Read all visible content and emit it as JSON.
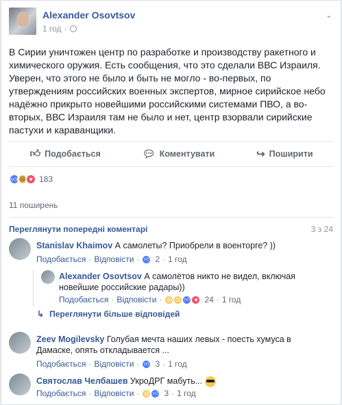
{
  "post": {
    "author": "Alexander Osovtsov",
    "time": "1 год",
    "privacy_icon": "globe-icon",
    "text": "В Сирии уничтожен центр по разработке и производству ракетного и химического оружия. Есть сообщения, что это сделали ВВС Израиля. Уверен, что этого не было и быть не могло - во-первых, по утверждениям российских военных экспертов, мирное сирийское небо надёжно прикрыто новейшими российскими системами ПВО, а во-вторых, ВВС Израиля там не было и нет, центр взорвали сирийские пастухи и караванщики."
  },
  "actions": {
    "like": "Подобається",
    "comment": "Коментувати",
    "share": "Поширити"
  },
  "reactions": {
    "count": "183"
  },
  "shares": "11 поширень",
  "comments_header": {
    "prev": "Переглянути попередні коментарі",
    "pages": "3 з 24"
  },
  "comments": [
    {
      "name": "Stanislav Khaimov",
      "text": "А самолеты? Приобрели в военторге? ))",
      "like": "Подобається",
      "reply": "Відповісти",
      "count": "2",
      "time": "1 год"
    },
    {
      "name": "Alexander Osovtsov",
      "text": "А самолётов никто не видел, включая новейшие российские радары))",
      "like": "Подобається",
      "reply": "Відповісти",
      "count": "24",
      "time": "1 год"
    },
    {
      "name": "Zeev Mogilevsky",
      "text": "Голубая мечта наших левых - поесть хумуса в Дамаске, опять откладывается ...",
      "like": "Подобається",
      "reply": "Відповісти",
      "count": "3",
      "time": "1 год"
    },
    {
      "name": "Святослав Челбашев",
      "text": "УкроДРГ мабуть...",
      "like": "Подобається",
      "reply": "Відповісти",
      "count": "3",
      "time": "1 год"
    }
  ],
  "more_replies": "Переглянути більше відповідей"
}
